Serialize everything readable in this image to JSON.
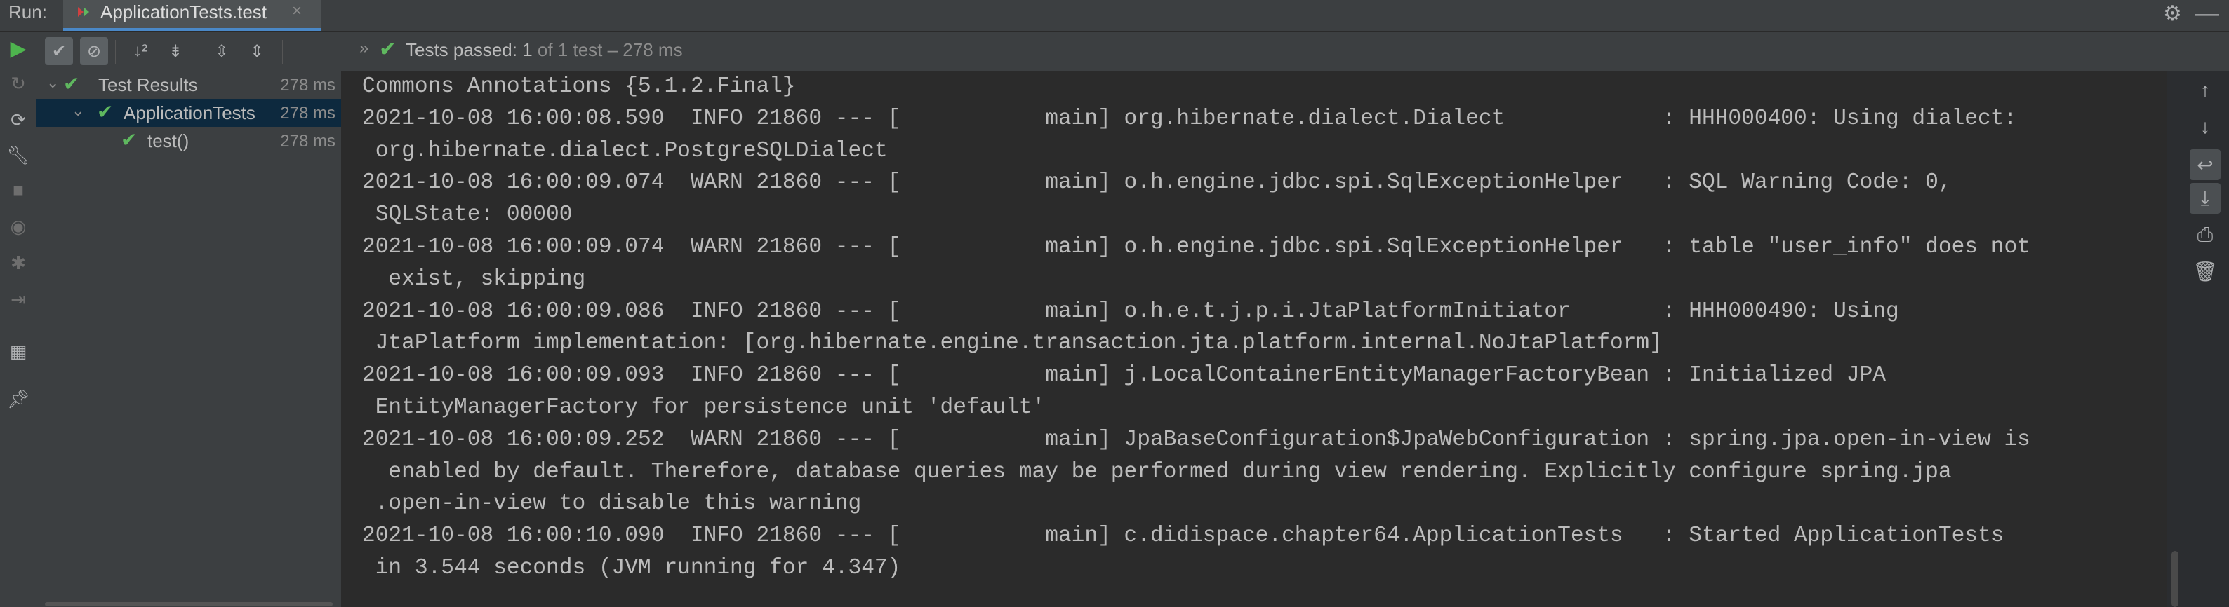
{
  "run_bar": {
    "label": "Run:",
    "tab_title": "ApplicationTests.test",
    "tab_close": "×",
    "settings_icon": "gear-icon",
    "minimize_icon": "minimize-icon"
  },
  "test_toolbar": {
    "status_prefix": "Tests passed: ",
    "passed_count": "1",
    "status_suffix": " of 1 test – 278 ms"
  },
  "tree": [
    {
      "label": "Test Results",
      "time": "278 ms",
      "level": 0
    },
    {
      "label": "ApplicationTests",
      "time": "278 ms",
      "level": 1,
      "selected": true
    },
    {
      "label": "test()",
      "time": "278 ms",
      "level": 2
    }
  ],
  "console_lines": [
    "Commons Annotations {5.1.2.Final}",
    "2021-10-08 16:00:08.590  INFO 21860 --- [           main] org.hibernate.dialect.Dialect            : HHH000400: Using dialect:",
    " org.hibernate.dialect.PostgreSQLDialect",
    "2021-10-08 16:00:09.074  WARN 21860 --- [           main] o.h.engine.jdbc.spi.SqlExceptionHelper   : SQL Warning Code: 0,",
    " SQLState: 00000",
    "2021-10-08 16:00:09.074  WARN 21860 --- [           main] o.h.engine.jdbc.spi.SqlExceptionHelper   : table \"user_info\" does not",
    "  exist, skipping",
    "2021-10-08 16:00:09.086  INFO 21860 --- [           main] o.h.e.t.j.p.i.JtaPlatformInitiator       : HHH000490: Using",
    " JtaPlatform implementation: [org.hibernate.engine.transaction.jta.platform.internal.NoJtaPlatform]",
    "2021-10-08 16:00:09.093  INFO 21860 --- [           main] j.LocalContainerEntityManagerFactoryBean : Initialized JPA",
    " EntityManagerFactory for persistence unit 'default'",
    "2021-10-08 16:00:09.252  WARN 21860 --- [           main] JpaBaseConfiguration$JpaWebConfiguration : spring.jpa.open-in-view is",
    "  enabled by default. Therefore, database queries may be performed during view rendering. Explicitly configure spring.jpa",
    " .open-in-view to disable this warning",
    "2021-10-08 16:00:10.090  INFO 21860 --- [           main] c.didispace.chapter64.ApplicationTests   : Started ApplicationTests",
    " in 3.544 seconds (JVM running for 4.347)"
  ],
  "colors": {
    "accent": "#4a88c7",
    "pass_green": "#5fb85f",
    "run_green": "#4eb44e",
    "selection": "#0d293e"
  }
}
